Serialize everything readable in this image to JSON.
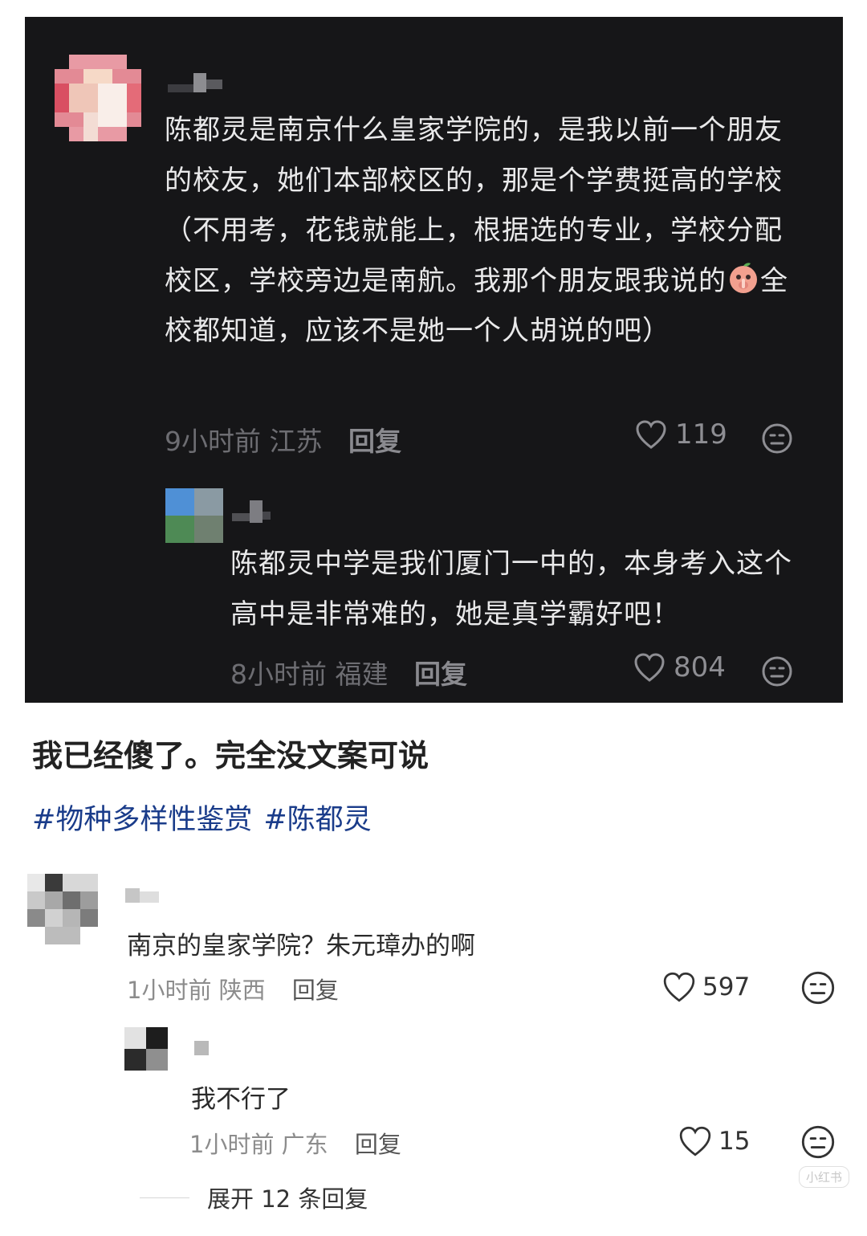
{
  "screenshot_comments": [
    {
      "text": "陈都灵是南京什么皇家学院的，是我以前一个朋友的校友，她们本部校区的，那是个学费挺高的学校（不用考，花钱就能上，根据选的专业，学校分配校区，学校旁边是南航。我那个朋友跟我说的",
      "text_after_emoji": "全校都知道，应该不是她一个人胡说的吧）",
      "emoji_icon": "shush-peach-emoji",
      "time": "9小时前",
      "location": "江苏",
      "reply_label": "回复",
      "likes": "119"
    },
    {
      "text": "陈都灵中学是我们厦门一中的，本身考入这个高中是非常难的，她是真学霸好吧！",
      "time": "8小时前",
      "location": "福建",
      "reply_label": "回复",
      "likes": "804"
    }
  ],
  "post": {
    "caption": "我已经傻了。完全没文案可说",
    "tags": [
      "#物种多样性鉴赏",
      "#陈都灵"
    ]
  },
  "comments": [
    {
      "text": "南京的皇家学院？朱元璋办的啊",
      "time": "1小时前",
      "location": "陕西",
      "reply_label": "回复",
      "likes": "597"
    },
    {
      "text": "我不行了",
      "time": "1小时前",
      "location": "广东",
      "reply_label": "回复",
      "likes": "15"
    }
  ],
  "expand_replies_label": "展开 12 条回复",
  "watermark": "小红书",
  "colors": {
    "dark_bg": "#161618",
    "hashtag": "#1a3c8a"
  }
}
